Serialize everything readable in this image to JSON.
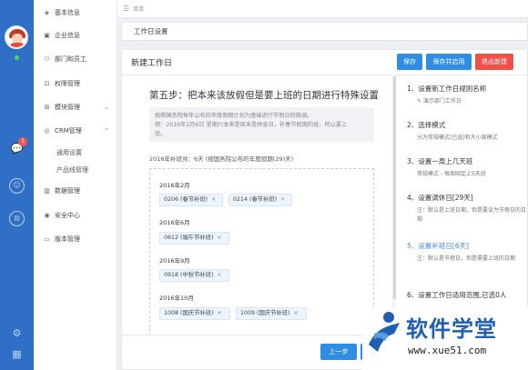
{
  "menu": {
    "items": [
      {
        "label": "基本信息",
        "icon": "layers-icon"
      },
      {
        "label": "企业信息",
        "icon": "building-icon"
      },
      {
        "label": "部门和员工",
        "icon": "users-icon"
      },
      {
        "label": "权限管理",
        "icon": "lock-icon"
      },
      {
        "label": "模块管理",
        "icon": "modules-icon"
      },
      {
        "label": "CRM管理",
        "icon": "crm-icon"
      },
      {
        "label": "数据管理",
        "icon": "data-icon"
      },
      {
        "label": "安全中心",
        "icon": "shield-icon"
      },
      {
        "label": "版本管理",
        "icon": "version-icon"
      }
    ],
    "crm_sub": [
      "通用设置",
      "产品线管理"
    ]
  },
  "rail": {
    "badge_count": "1"
  },
  "topbar": {
    "crumb": "菜单"
  },
  "page_title": "工作日设置",
  "panel": {
    "title": "新建工作日",
    "buttons": {
      "save": "保存",
      "save_enable": "保存并启用",
      "exit": "退出新建"
    }
  },
  "content": {
    "heading": "第五步：把本来该放假但是要上班的日期进行特殊设置",
    "notice_line1": "按照国务院每年公布的年度假期计划为基础进行节假日的微调。",
    "notice_line2": "例：2016年2月6日 星期六本来是周末是休息日，补春节假期的班，所以要上",
    "notice_line3": "班。",
    "extra_days": "2016年补班共：6天 (按国务院公布的年度假期(29)天)",
    "months": [
      {
        "label": "2016年2月",
        "tags": [
          "0206 (春节补班)",
          "0214 (春节补班)"
        ]
      },
      {
        "label": "2016年6月",
        "tags": [
          "0612 (端午节补班)"
        ]
      },
      {
        "label": "2016年9月",
        "tags": [
          "0918 (中秋节补班)"
        ]
      },
      {
        "label": "2016年10月",
        "tags": [
          "1008 (国庆节补班)",
          "1009 (国庆节补班)"
        ]
      }
    ],
    "remove_glyph": "×",
    "prev_button": "上一步"
  },
  "steps": [
    {
      "title": "1、设置新工作日规则名称",
      "desc": "✎ 演示部门工作日",
      "active": false
    },
    {
      "title": "2、选择模式",
      "desc": "分为常规模式(已选)和大小周模式",
      "active": false
    },
    {
      "title": "3、设置一周上几天班",
      "desc": "常规模式 - 每周固定上5天班",
      "active": false
    },
    {
      "title": "4、设置调休日[29天]",
      "desc": "注：默认是上班日期，但是要设为节假日的日期",
      "active": false
    },
    {
      "title": "5、设置补班日[6天]",
      "desc": "注：默认是节假日，但是需要上班的日期",
      "active": true
    },
    {
      "title": "6、设置工作日适用范围,已选0人",
      "desc": "",
      "active": false
    }
  ],
  "watermark": {
    "text": "软件学堂",
    "url": "www.xue51.com"
  },
  "colors": {
    "primary": "#2f8de4",
    "danger": "#f0504a",
    "rail": "#2f6fc5",
    "active_step": "#3b8de4"
  }
}
